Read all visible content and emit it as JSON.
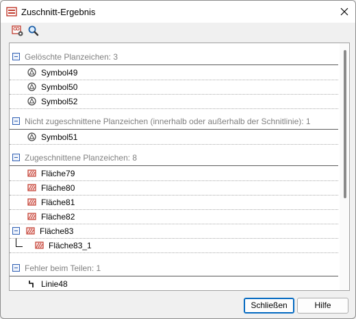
{
  "window": {
    "title": "Zuschnitt-Ergebnis"
  },
  "toolbar": {
    "buttons": [
      {
        "icon": "cut-settings-icon"
      },
      {
        "icon": "magnifier-icon"
      }
    ]
  },
  "groups": [
    {
      "header": "Gelöschte Planzeichen: 3",
      "items": [
        {
          "label": "Symbol49",
          "icon": "symbol-icon"
        },
        {
          "label": "Symbol50",
          "icon": "symbol-icon"
        },
        {
          "label": "Symbol52",
          "icon": "symbol-icon"
        }
      ]
    },
    {
      "header": "Nicht zugeschnittene Planzeichen (innerhalb oder außerhalb der Schnitlinie): 1",
      "items": [
        {
          "label": "Symbol51",
          "icon": "symbol-icon"
        }
      ]
    },
    {
      "header": "Zugeschnittene Planzeichen: 8",
      "items": [
        {
          "label": "Fläche79",
          "icon": "hatched-area-icon"
        },
        {
          "label": "Fläche80",
          "icon": "hatched-area-icon"
        },
        {
          "label": "Fläche81",
          "icon": "hatched-area-icon"
        },
        {
          "label": "Fläche82",
          "icon": "hatched-area-icon"
        },
        {
          "label": "Fläche83",
          "icon": "hatched-area-icon",
          "expanded": true
        },
        {
          "label": "Fläche83_1",
          "icon": "hatched-area-icon",
          "child": true
        }
      ]
    },
    {
      "header": "Fehler beim Teilen: 1",
      "items": [
        {
          "label": "Linie48",
          "icon": "line-icon"
        }
      ]
    }
  ],
  "buttons": {
    "close_label": "Schließen",
    "help_label": "Hilfe"
  },
  "colors": {
    "accent": "#0067c0",
    "header_text": "#808080",
    "hatch": "#c0392b"
  }
}
